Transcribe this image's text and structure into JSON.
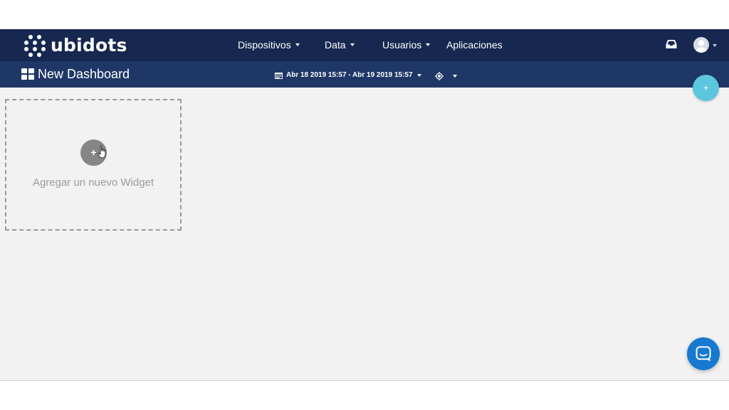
{
  "brand": {
    "name": "ubidots",
    "color": "#16284f",
    "accent": "#1e3766"
  },
  "nav": {
    "items": [
      {
        "label": "Dispositivos",
        "has_caret": true
      },
      {
        "label": "Data",
        "has_caret": true
      },
      {
        "label": "Usuarios",
        "has_caret": true
      },
      {
        "label": "Aplicaciones",
        "has_caret": false
      }
    ],
    "icons": [
      "inbox-icon",
      "avatar"
    ]
  },
  "dashboard": {
    "title": "New Dashboard",
    "title_icon": "dashboard-grid-icon",
    "date_range": "Abr 18 2019 15:57 - Abr 19 2019 15:57",
    "date_icon": "calendar-icon",
    "realtime_icon": "target-icon"
  },
  "fab": {
    "label": "+",
    "color": "#5dc5dd"
  },
  "widget_placeholder": {
    "add_label": "+",
    "text": "Agregar un nuevo Widget"
  },
  "chat": {
    "icon": "chat-bubble-icon",
    "color": "#1779d0"
  }
}
